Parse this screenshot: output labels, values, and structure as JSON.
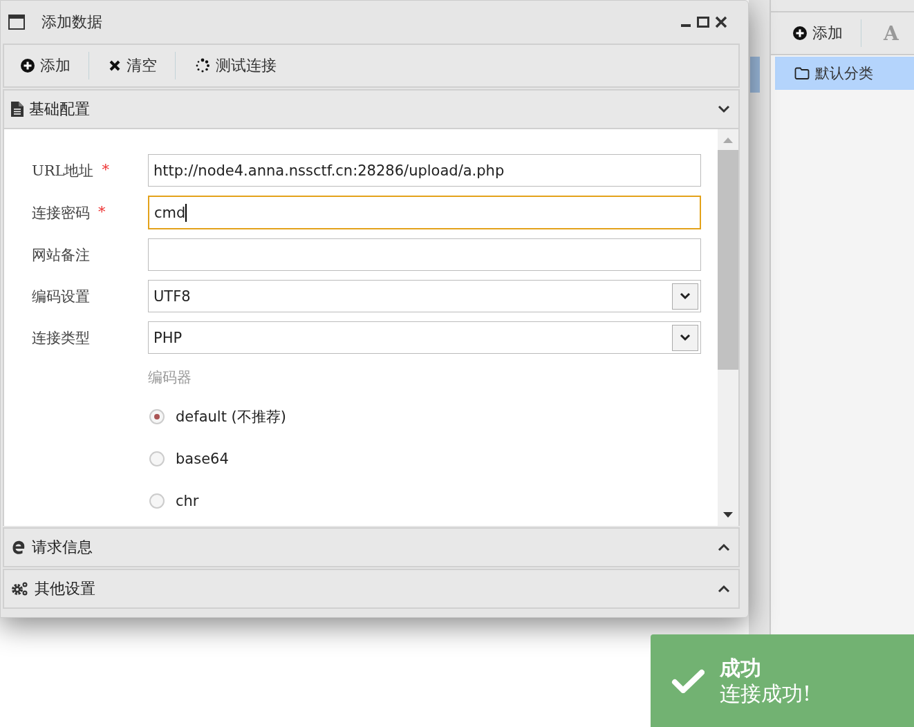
{
  "window": {
    "title": "添加数据"
  },
  "toolbar": [
    {
      "kind": "add",
      "label": "添加"
    },
    {
      "kind": "clear",
      "label": "清空"
    },
    {
      "kind": "test",
      "label": "测试连接"
    }
  ],
  "sections": [
    {
      "kind": "basic",
      "title": "基础配置",
      "expanded": true
    },
    {
      "kind": "request",
      "title": "请求信息",
      "expanded": false
    },
    {
      "kind": "other",
      "title": "其他设置",
      "expanded": false
    }
  ],
  "fields": [
    {
      "label": "URL地址",
      "required": true,
      "kind": "text",
      "value": "http://node4.anna.nssctf.cn:28286/upload/a.php",
      "focused": false
    },
    {
      "label": "连接密码",
      "required": true,
      "kind": "text",
      "value": "cmd",
      "focused": true
    },
    {
      "label": "网站备注",
      "required": false,
      "kind": "text",
      "focused": false
    },
    {
      "label": "编码设置",
      "required": false,
      "kind": "select",
      "value": "UTF8",
      "focused": false
    },
    {
      "label": "连接类型",
      "required": false,
      "kind": "select",
      "value": "PHP",
      "focused": false
    }
  ],
  "required_mark": "*",
  "encoder": {
    "label": "编码器",
    "options": [
      {
        "label": "default (不推荐)",
        "selected": true
      },
      {
        "label": "base64",
        "selected": false
      },
      {
        "label": "chr",
        "selected": false
      }
    ]
  },
  "side_panel": {
    "toolbar": [
      {
        "kind": "add",
        "label": "添加"
      },
      {
        "kind": "letter",
        "label": "A"
      }
    ],
    "items": [
      {
        "label": "默认分类",
        "selected": true
      }
    ]
  },
  "toast": {
    "title": "成功",
    "message": "连接成功!"
  }
}
